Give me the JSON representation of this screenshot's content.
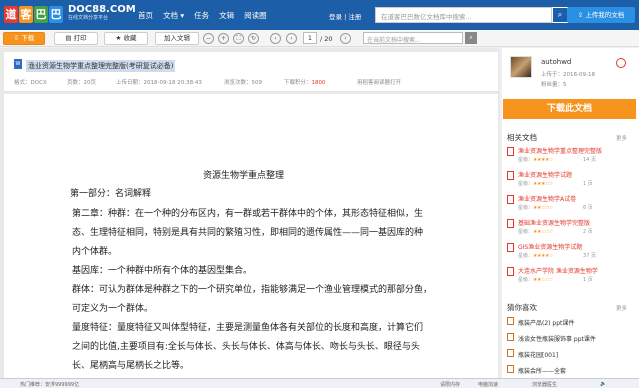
{
  "brand": {
    "blocks": [
      "道",
      "客",
      "巴",
      "巴"
    ],
    "block_colors": [
      "#e53935",
      "#f7941d",
      "#43a047",
      "#2b8fe3"
    ],
    "name": "DOC88.COM",
    "tagline": "在线文档分享平台"
  },
  "nav": {
    "links": [
      "首页",
      "文档 ▾",
      "任务",
      "文辑",
      "阅读圈"
    ],
    "login": "登录",
    "sep": "|",
    "register": "注册",
    "search_placeholder": "在道客巴巴数亿文档库中搜索...",
    "search_icon": "search-icon",
    "upload_label": "⇪ 上传我的文档"
  },
  "toolbar": {
    "download": "⇩ 下载",
    "print": "打印",
    "favorite": "★ 收藏",
    "add_to": "加入文辑",
    "page_current": "1",
    "page_total": "/ 20",
    "search_placeholder": "在当前文档中搜索..."
  },
  "doc": {
    "title": "渔业资源生物学重点整理完整版(考研复试必备)",
    "format": "格式：DOCX",
    "pages": "页数：20页",
    "upload_time": "上传日期：2018-09-18 20:38:43",
    "reads": "浏览次数：509",
    "points_label": "下载积分：",
    "points": "1800",
    "open_app": "用稻客阅读器打开"
  },
  "content": {
    "heading": "资源生物学重点整理",
    "lines": [
      "第一部分：名词解释",
      "第二章：种群：在一个种的分布区内，有一群或若干群体中的个体，其形态特征相似，生",
      "态、生理特征相同，特别是具有共同的繁殖习性，即相同的遗传属性——同一基因库的种",
      "内个体群。",
      "基因库：一个种群中所有个体的基因型集合。",
      "群体：可认为群体是种群之下的一个研究单位，指能够满足一个渔业管理模式的那部分鱼，",
      "可定义为一个群体。",
      "量度特征：量度特征又叫体型特征，主要是测量鱼体各有关部位的长度和高度，计算它们",
      "之间的比值,主要项目有:全长与体长、头长与体长、体高与体长、吻长与头长、眼径与头",
      "长、尾柄高与尾柄长之比等。"
    ]
  },
  "sidebar": {
    "uploader": "autohwd",
    "upload_date": "上传于：2018-09-18",
    "score": "粉丝量：5",
    "download_button": "下载此文档",
    "related_title": "相关文档",
    "more": "更多",
    "related": [
      {
        "title": "渔业资源生物学重点整理完整版",
        "rating_label": "星级：",
        "stars": "★★★★☆",
        "pages": "14 页"
      },
      {
        "title": "渔业资源生物学试题",
        "rating_label": "星级：",
        "stars": "★★★☆☆",
        "pages": "1 页"
      },
      {
        "title": "渔业资源生物学A试卷",
        "rating_label": "星级：",
        "stars": "★★☆☆☆",
        "pages": "6 页"
      },
      {
        "title": "基础渔业资源生物学完整版",
        "rating_label": "星级：",
        "stars": "★★☆☆☆",
        "pages": "2 页"
      },
      {
        "title": "GIS渔业资源生物学试题",
        "rating_label": "星级：",
        "stars": "★★★★☆",
        "pages": "37 页"
      },
      {
        "title": "大连水产学院 渔业资源生物学",
        "rating_label": "星级：",
        "stars": "★★☆☆☆",
        "pages": "1 页"
      }
    ],
    "likes_title": "猜你喜欢",
    "likes": [
      "瓶装产品(2) ppt课件",
      "浅谈女性瓶装服饰事 ppt课件",
      "瓶装花园[001]",
      "瓶装会所——全套"
    ]
  },
  "status": {
    "hot": "热门推荐：安浮999999亿",
    "items": [
      "请限内存",
      "电脑加速",
      "浏览器医生"
    ]
  }
}
